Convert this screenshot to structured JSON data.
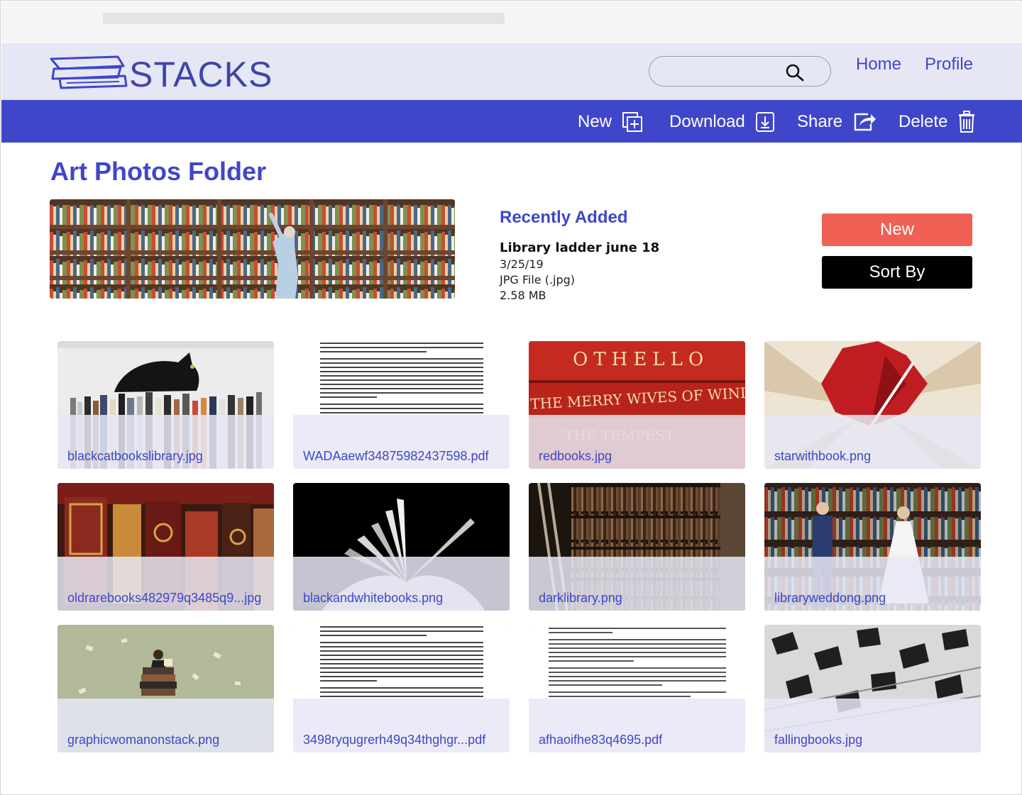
{
  "app": {
    "name": "STACKS",
    "colors": {
      "primary": "#3f46c9",
      "header_bg": "#e6e7f5",
      "new_button": "#f16055",
      "sort_button": "#000000"
    }
  },
  "header": {
    "search": {
      "placeholder": "",
      "value": ""
    },
    "nav": [
      {
        "label": "Home"
      },
      {
        "label": "Profile"
      }
    ]
  },
  "toolbar": {
    "new_label": "New",
    "download_label": "Download",
    "share_label": "Share",
    "delete_label": "Delete"
  },
  "main": {
    "title": "Art Photos Folder",
    "recently_added": {
      "heading": "Recently Added",
      "name": "Library ladder june 18",
      "date": "3/25/19",
      "type": "JPG File (.jpg)",
      "size": "2.58 MB"
    },
    "actions": {
      "new_label": "New",
      "sort_label": "Sort By"
    },
    "files": [
      {
        "name": "blackcatbookslibrary.jpg",
        "kind": "image"
      },
      {
        "name": "WADAaewf34875982437598.pdf",
        "kind": "document"
      },
      {
        "name": "redbooks.jpg",
        "kind": "image"
      },
      {
        "name": "starwithbook.png",
        "kind": "image"
      },
      {
        "name": "oldrarebooks482979q3485q9...jpg",
        "kind": "image"
      },
      {
        "name": "blackandwhitebooks.png",
        "kind": "image"
      },
      {
        "name": "darklibrary.png",
        "kind": "image"
      },
      {
        "name": "libraryweddong.png",
        "kind": "image"
      },
      {
        "name": "graphicwomanonstack.png",
        "kind": "image"
      },
      {
        "name": "3498ryqugrerh49q34thghgr...pdf",
        "kind": "document"
      },
      {
        "name": "afhaoifhe83q4695.pdf",
        "kind": "document"
      },
      {
        "name": "fallingbooks.jpg",
        "kind": "image"
      }
    ]
  }
}
